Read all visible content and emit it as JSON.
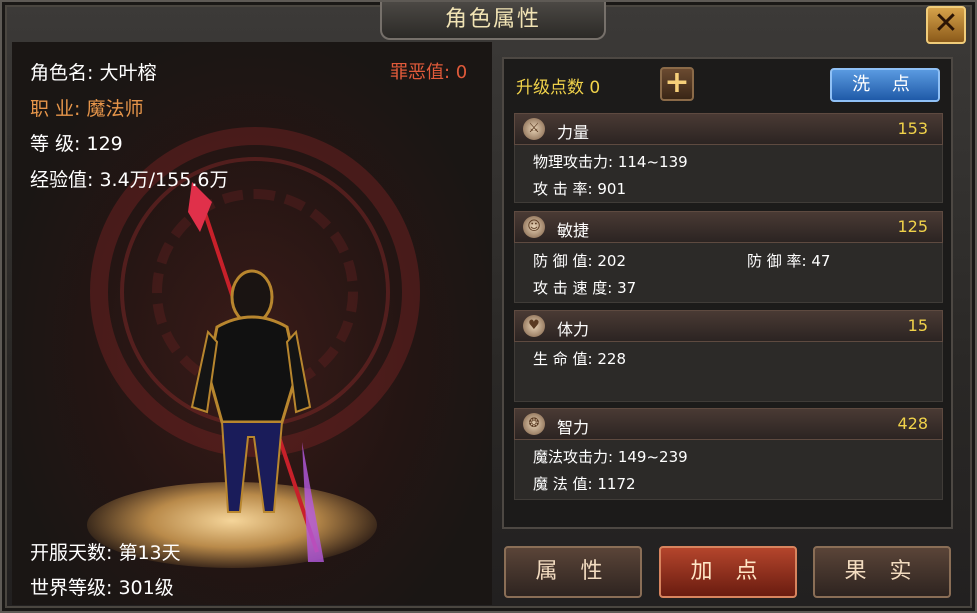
{
  "window": {
    "title": "角色属性"
  },
  "character": {
    "name_line": "角色名: 大叶榕",
    "class_line": "职   业: 魔法师",
    "level_line": "等   级: 129",
    "exp_line": "经验值: 3.4万/155.6万",
    "sin_line": "罪恶值: 0",
    "server_days_line": "开服天数: 第13天",
    "world_level_line": "世界等级: 301级"
  },
  "upgrade": {
    "points_label": "升级点数 0",
    "plus_icon": "+",
    "wash_label": "洗 点"
  },
  "attributes": [
    {
      "icon": "sword-icon",
      "icon_glyph": "⚔",
      "name": "力量",
      "value": "153",
      "stats": [
        "物理攻击力: 114~139",
        "攻    击    率: 901"
      ]
    },
    {
      "icon": "agility-icon",
      "icon_glyph": "☺",
      "name": "敏捷",
      "value": "125",
      "stats": [
        "防    御    值: 202",
        "防    御    率: 47",
        "攻  击  速  度: 37"
      ]
    },
    {
      "icon": "heart-icon",
      "icon_glyph": "♥",
      "name": "体力",
      "value": "15",
      "stats": [
        "生    命    值: 228"
      ]
    },
    {
      "icon": "spiral-icon",
      "icon_glyph": "❂",
      "name": "智力",
      "value": "428",
      "stats": [
        "魔法攻击力: 149~239",
        "魔    法    值: 1172"
      ]
    }
  ],
  "tabs": {
    "attributes": "属 性",
    "add_points": "加 点",
    "fruits": "果 实"
  },
  "close_glyph": "✕",
  "colors": {
    "accent_gold": "#f0d24a",
    "sin_red": "#e05a3a",
    "class_orange": "#e6954a",
    "active_tab": "#b4452c",
    "wash_blue": "#1f5aa8"
  }
}
